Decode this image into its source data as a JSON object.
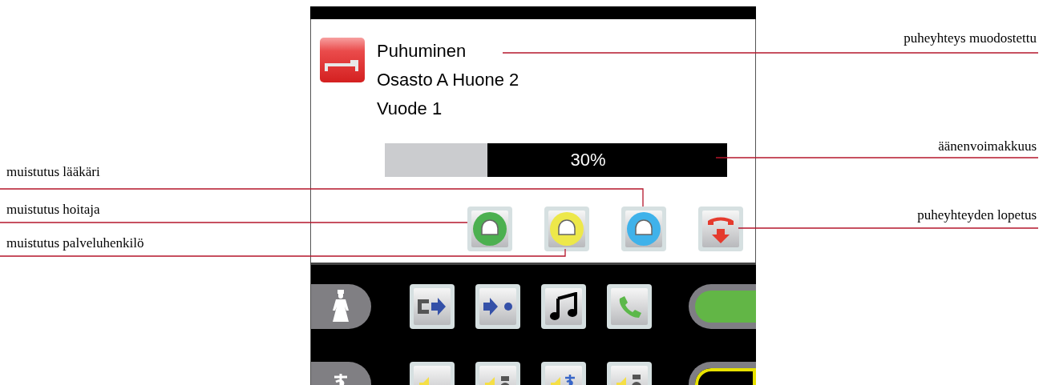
{
  "call": {
    "status": "Puhuminen",
    "location": "Osasto A Huone 2",
    "bed": "Vuode 1"
  },
  "volume": {
    "level": 0.3,
    "reading": "30%"
  },
  "reminder_buttons": [
    {
      "color": "#4cb050"
    },
    {
      "color": "#ede84a"
    },
    {
      "color": "#3fb2ea"
    }
  ],
  "callouts": [
    {
      "text": "puheyhteys muodostettu"
    },
    {
      "text": "äänenvoimakkuus"
    },
    {
      "text": "puheyhteyden lopetus"
    },
    {
      "text": "muistutus lääkäri"
    },
    {
      "text": "muistutus hoitaja"
    },
    {
      "text": "muistutus palveluhenkilö"
    }
  ]
}
